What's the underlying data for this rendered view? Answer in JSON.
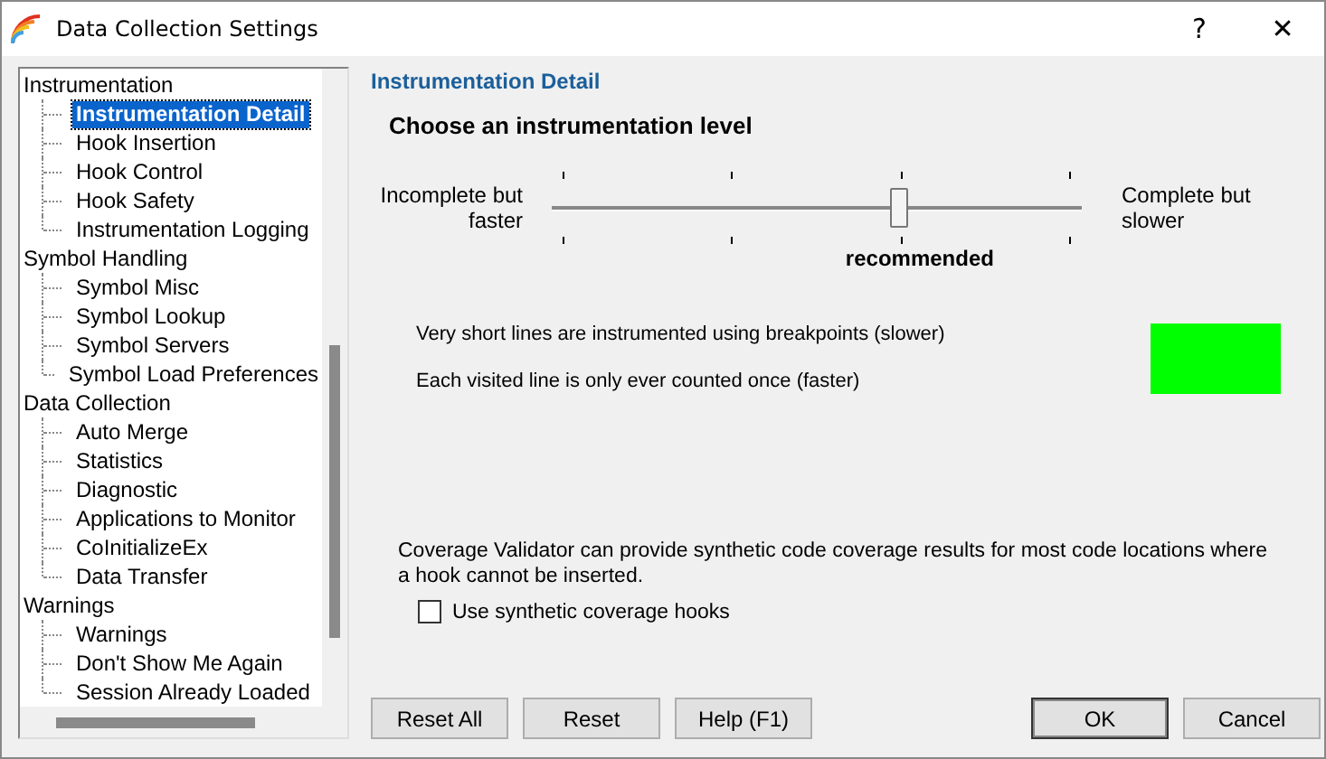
{
  "window": {
    "title": "Data Collection Settings",
    "help_button": "?",
    "close_button": "✕"
  },
  "tree": [
    {
      "label": "Instrumentation",
      "selected": false,
      "children": [
        {
          "label": "Instrumentation Detail",
          "selected": true
        },
        {
          "label": "Hook Insertion",
          "selected": false
        },
        {
          "label": "Hook Control",
          "selected": false
        },
        {
          "label": "Hook Safety",
          "selected": false
        },
        {
          "label": "Instrumentation Logging",
          "selected": false
        }
      ]
    },
    {
      "label": "Symbol Handling",
      "selected": false,
      "children": [
        {
          "label": "Symbol Misc",
          "selected": false
        },
        {
          "label": "Symbol Lookup",
          "selected": false
        },
        {
          "label": "Symbol Servers",
          "selected": false
        },
        {
          "label": "Symbol Load Preferences",
          "selected": false
        }
      ]
    },
    {
      "label": "Data Collection",
      "selected": false,
      "children": [
        {
          "label": "Auto Merge",
          "selected": false
        },
        {
          "label": "Statistics",
          "selected": false
        },
        {
          "label": "Diagnostic",
          "selected": false
        },
        {
          "label": "Applications to Monitor",
          "selected": false
        },
        {
          "label": "CoInitializeEx",
          "selected": false
        },
        {
          "label": "Data Transfer",
          "selected": false
        }
      ]
    },
    {
      "label": "Warnings",
      "selected": false,
      "children": [
        {
          "label": "Warnings",
          "selected": false
        },
        {
          "label": "Don't Show Me Again",
          "selected": false
        },
        {
          "label": "Session Already Loaded",
          "selected": false
        }
      ]
    }
  ],
  "panel": {
    "heading": "Instrumentation Detail",
    "subheading": "Choose an instrumentation level",
    "slider": {
      "left_label": "Incomplete but faster",
      "right_label": "Complete but slower",
      "level": 0.667,
      "caption": "recommended"
    },
    "descriptions": [
      "Very short lines are instrumented using breakpoints (slower)",
      "Each visited line is only ever counted once (faster)"
    ],
    "indicator": {
      "color": "#00ff00"
    },
    "note": "Coverage Validator can provide synthetic code coverage results for most code locations where a hook cannot be inserted.",
    "checkbox": {
      "label": "Use synthetic coverage hooks",
      "checked": false
    }
  },
  "buttons_left": [
    "Reset All",
    "Reset",
    "Help (F1)"
  ],
  "buttons_right": [
    "OK",
    "Cancel"
  ]
}
